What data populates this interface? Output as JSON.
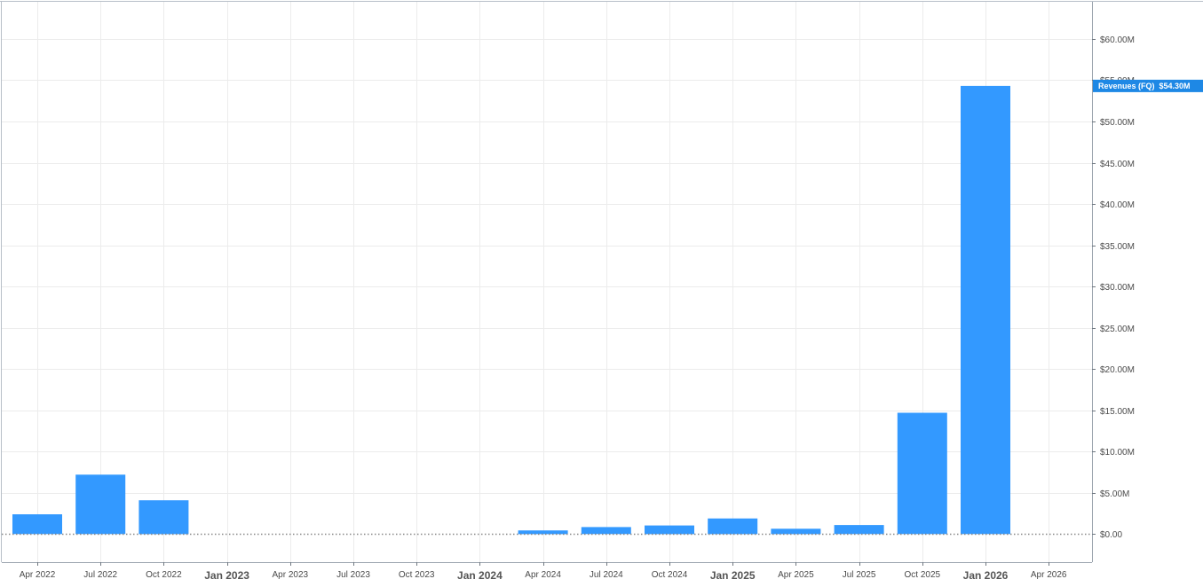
{
  "chart_data": {
    "type": "bar",
    "categories": [
      "Apr 2022",
      "Jul 2022",
      "Oct 2022",
      "Jan 2023",
      "Apr 2023",
      "Jul 2023",
      "Oct 2023",
      "Jan 2024",
      "Apr 2024",
      "Jul 2024",
      "Oct 2024",
      "Jan 2025",
      "Apr 2025",
      "Jul 2025",
      "Oct 2025",
      "Jan 2026"
    ],
    "series": [
      {
        "name": "Revenues (FQ)",
        "values": [
          2.4,
          7.2,
          4.1,
          0,
          0,
          0,
          0,
          0,
          0.45,
          0.85,
          1.05,
          1.9,
          0.65,
          1.1,
          14.7,
          54.3
        ],
        "color": "#3399ff"
      }
    ],
    "x_ticks": [
      {
        "label": "Apr 2022",
        "major": false
      },
      {
        "label": "Jul 2022",
        "major": false
      },
      {
        "label": "Oct 2022",
        "major": false
      },
      {
        "label": "Jan 2023",
        "major": true
      },
      {
        "label": "Apr 2023",
        "major": false
      },
      {
        "label": "Jul 2023",
        "major": false
      },
      {
        "label": "Oct 2023",
        "major": false
      },
      {
        "label": "Jan 2024",
        "major": true
      },
      {
        "label": "Apr 2024",
        "major": false
      },
      {
        "label": "Jul 2024",
        "major": false
      },
      {
        "label": "Oct 2024",
        "major": false
      },
      {
        "label": "Jan 2025",
        "major": true
      },
      {
        "label": "Apr 2025",
        "major": false
      },
      {
        "label": "Jul 2025",
        "major": false
      },
      {
        "label": "Oct 2025",
        "major": false
      },
      {
        "label": "Jan 2026",
        "major": true
      },
      {
        "label": "Apr 2026",
        "major": false
      }
    ],
    "y_ticks": [
      {
        "value": 0,
        "label": "$0.00"
      },
      {
        "value": 5,
        "label": "$5.00M"
      },
      {
        "value": 10,
        "label": "$10.00M"
      },
      {
        "value": 15,
        "label": "$15.00M"
      },
      {
        "value": 20,
        "label": "$20.00M"
      },
      {
        "value": 25,
        "label": "$25.00M"
      },
      {
        "value": 30,
        "label": "$30.00M"
      },
      {
        "value": 35,
        "label": "$35.00M"
      },
      {
        "value": 40,
        "label": "$40.00M"
      },
      {
        "value": 45,
        "label": "$45.00M"
      },
      {
        "value": 50,
        "label": "$50.00M"
      },
      {
        "value": 55,
        "label": "$55.00M"
      },
      {
        "value": 60,
        "label": "$60.00M"
      }
    ],
    "ylim": [
      -3.4,
      64.5
    ],
    "y_unit": "$M",
    "grid": true,
    "zero_line": "dotted",
    "last_value_badge": {
      "text": "Revenues (FQ)  $54.30M",
      "value": 54.3,
      "color": "#1e88e5"
    },
    "title": "",
    "xlabel": "",
    "ylabel": ""
  }
}
